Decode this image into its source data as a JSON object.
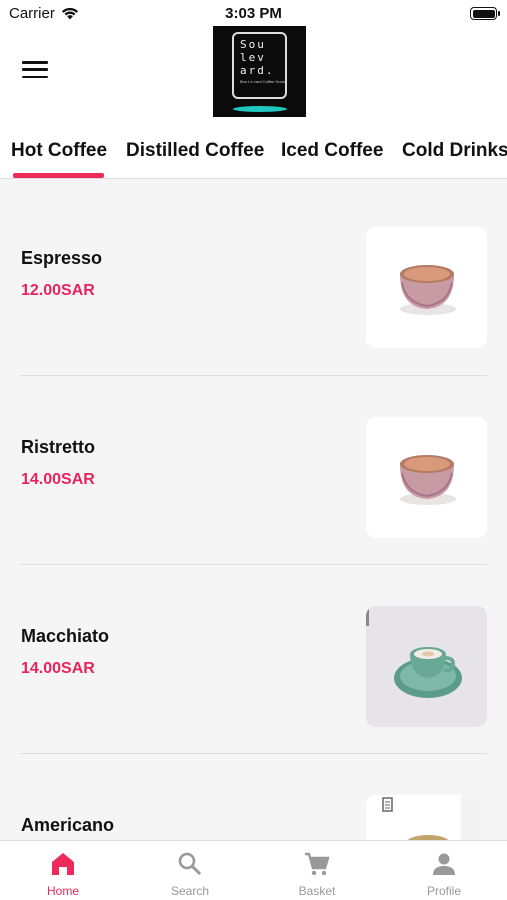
{
  "status_bar": {
    "carrier": "Carrier",
    "time": "3:03 PM"
  },
  "header": {
    "logo_lines": [
      "Sou",
      "lev",
      "ard."
    ],
    "logo_tagline": "Bou Le vard Coffee House"
  },
  "tabs": [
    {
      "label": "Hot Coffee",
      "active": true
    },
    {
      "label": "Distilled Coffee",
      "active": false
    },
    {
      "label": "Iced Coffee",
      "active": false
    },
    {
      "label": "Cold Drinks",
      "active": false
    }
  ],
  "menu_items": [
    {
      "name": "Espresso",
      "price": "12.00SAR",
      "image": "espresso-cup-image"
    },
    {
      "name": "Ristretto",
      "price": "14.00SAR",
      "image": "ristretto-cup-image"
    },
    {
      "name": "Macchiato",
      "price": "14.00SAR",
      "image": "macchiato-cup-image"
    },
    {
      "name": "Americano",
      "price": "",
      "image": "americano-cup-image"
    }
  ],
  "bottom_nav": [
    {
      "label": "Home",
      "icon": "home-icon",
      "active": true
    },
    {
      "label": "Search",
      "icon": "search-icon",
      "active": false
    },
    {
      "label": "Basket",
      "icon": "cart-icon",
      "active": false
    },
    {
      "label": "Profile",
      "icon": "profile-icon",
      "active": false
    }
  ],
  "colors": {
    "accent": "#ee2a5a",
    "price": "#e8245c",
    "background": "#f5f5f5",
    "inactive": "#999999"
  }
}
